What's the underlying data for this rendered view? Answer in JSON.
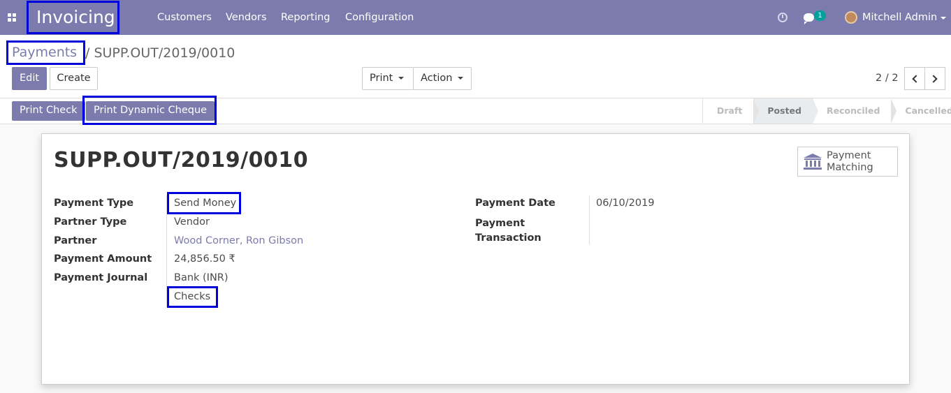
{
  "navbar": {
    "app_name": "Invoicing",
    "menu": [
      "Customers",
      "Vendors",
      "Reporting",
      "Configuration"
    ],
    "message_count": "1",
    "user_name": "Mitchell Admin"
  },
  "breadcrumb": {
    "parent": "Payments",
    "current": "/ SUPP.OUT/2019/0010"
  },
  "buttons": {
    "edit": "Edit",
    "create": "Create",
    "print": "Print",
    "action": "Action"
  },
  "pager": {
    "value": "2 / 2"
  },
  "statusbar": {
    "print_check": "Print Check",
    "print_dynamic_cheque": "Print Dynamic Cheque",
    "stages": [
      "Draft",
      "Posted",
      "Reconciled",
      "Cancelled"
    ],
    "active_stage": "Posted"
  },
  "record": {
    "title": "SUPP.OUT/2019/0010",
    "smart_button": "Payment\nMatching",
    "smart_button_line1": "Payment",
    "smart_button_line2": "Matching",
    "fields": {
      "payment_type_label": "Payment Type",
      "payment_type": "Send Money",
      "partner_type_label": "Partner Type",
      "partner_type": "Vendor",
      "partner_label": "Partner",
      "partner": "Wood Corner, Ron Gibson",
      "payment_amount_label": "Payment Amount",
      "payment_amount": "24,856.50 ₹",
      "payment_journal_label": "Payment Journal",
      "payment_journal": "Bank (INR)",
      "payment_method": "Checks",
      "payment_date_label": "Payment Date",
      "payment_date": "06/10/2019",
      "payment_transaction_label_1": "Payment",
      "payment_transaction_label_2": "Transaction"
    }
  },
  "colors": {
    "brand": "#7c7bad",
    "highlight_border": "#0000dd",
    "badge": "#00a09d"
  }
}
